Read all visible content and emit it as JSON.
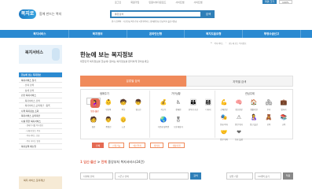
{
  "util": {
    "links": [
      "로그인",
      "회원가입",
      "민원서식다운로드",
      "사이트맵",
      "사이트맵"
    ],
    "selected_label": "화면 크기",
    "zoom": "100%"
  },
  "header": {
    "logo_text": "복지로",
    "slogan": "함께 만드는 복지",
    "search_placeholder": "통합검색",
    "search_button": "검색",
    "popular": "인기 검색어 : 기초연금  아동수당  국민행복카드  장애인연금  긴급복지  출산지원금"
  },
  "gnb": [
    "복지서비스",
    "복지정보",
    "온라인신청",
    "복지도움요청",
    "부정수급신고"
  ],
  "sidebar": {
    "title": "복지서비스",
    "items": [
      {
        "label": "한눈에 보는 복지정보",
        "type": "active"
      },
      {
        "label": "복지서비스 찾기",
        "type": "main"
      },
      {
        "label": "· 선택 검색",
        "type": "sub"
      },
      {
        "label": "· 상세 검색",
        "type": "sub"
      },
      {
        "label": "민간 복지서비스",
        "type": "main"
      },
      {
        "label": "· 복지서비스 검색",
        "type": "sub"
      },
      {
        "label": "· 복지서비스 모의계산 · 등록",
        "type": "sub"
      },
      {
        "label": "나의 복지정보 조회",
        "type": "main"
      },
      {
        "label": "복지서비스 모의계산",
        "type": "main"
      },
      {
        "label": "나를 위한 복지서비스",
        "type": "main"
      },
      {
        "label": "· 생애주기별 복지정보",
        "type": "sub2"
      },
      {
        "label": "· 나에게 맞는 복지",
        "type": "sub2"
      },
      {
        "label": "· 복지서비스 신청",
        "type": "sub2"
      },
      {
        "label": "· 복지 서비스 알림",
        "type": "sub2"
      },
      {
        "label": "복지정책 매뉴얼",
        "type": "main"
      }
    ],
    "banner": "복지 서비스 모의계산"
  },
  "breadcrumb": [
    "홈",
    "복지서비스",
    "한눈에 보는 복지정보"
  ],
  "main": {
    "title": "한눈에 보는 복지정보",
    "desc": "대한민국 복지정보를 한눈에! 원하는 복지정보를 편리하게 찾아보세요.",
    "tabs": [
      "분류별 검색",
      "지역별 검색"
    ],
    "columns": [
      "생애주기",
      "가구상황",
      "관심주제"
    ],
    "life": [
      {
        "label": "임신·출산",
        "icon": "🤰"
      },
      {
        "label": "영유아",
        "icon": "👶"
      },
      {
        "label": "아동",
        "icon": "🧒"
      },
      {
        "label": "청소년",
        "icon": "👦"
      },
      {
        "label": "청년",
        "icon": "🧑"
      },
      {
        "label": "중장년",
        "icon": "👨"
      },
      {
        "label": "노년",
        "icon": "👴"
      }
    ],
    "household": [
      {
        "label": "저소득",
        "icon": "💰"
      },
      {
        "label": "장애인",
        "icon": "♿"
      },
      {
        "label": "한부모·조손",
        "icon": "👪"
      },
      {
        "label": "다자녀",
        "icon": "👨‍👩‍👧‍👦"
      },
      {
        "label": "다문화·탈북민",
        "icon": "🌏"
      },
      {
        "label": "보훈대상자",
        "icon": "🎖"
      }
    ],
    "topics": [
      {
        "label": "신체건강",
        "icon": "💪"
      },
      {
        "label": "정신건강",
        "icon": "🧠"
      },
      {
        "label": "생활지원",
        "icon": "🏠"
      },
      {
        "label": "주거",
        "icon": "🏘"
      },
      {
        "label": "일자리",
        "icon": "💼"
      },
      {
        "label": "문화·여가",
        "icon": "🎭"
      },
      {
        "label": "안전·위기",
        "icon": "⚠"
      },
      {
        "label": "임신·출산",
        "icon": "🤱"
      },
      {
        "label": "보육",
        "icon": "🧸"
      },
      {
        "label": "교육",
        "icon": "📚"
      },
      {
        "label": "입양·위탁",
        "icon": "🤝"
      },
      {
        "label": "보호·돌봄",
        "icon": "❤"
      }
    ],
    "chips": [
      "전체",
      "신청가능",
      "예산연계",
      "재직자",
      "생활지원"
    ],
    "result": {
      "prefix": "1",
      "cat": "임신·출산",
      "sep": " > ",
      "scope": "전체",
      "rest": " 중앙부처 복지서비스(24건)"
    },
    "filters": {
      "sel1": "지자체 선택",
      "sel2": "시군구 선택",
      "input_placeholder": "",
      "search": "검색",
      "sel3": "정렬 기준",
      "sel4": "10개씩 보기",
      "apply": "적용"
    }
  },
  "colors": {
    "primary": "#2b8ad1",
    "accent": "#e56a53"
  }
}
